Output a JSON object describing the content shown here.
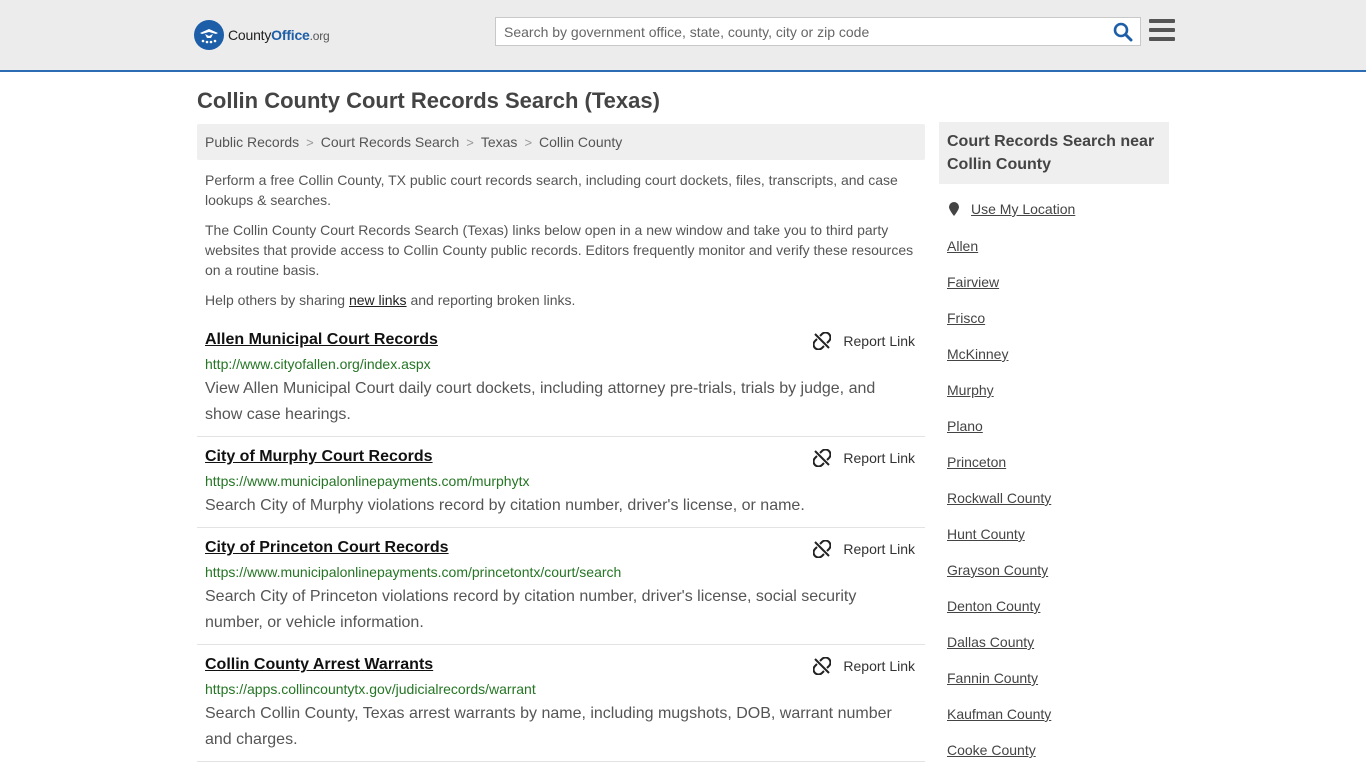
{
  "header": {
    "logo": {
      "word1": "County",
      "word2": "Office",
      "word3": ".org"
    },
    "search": {
      "placeholder": "Search by government office, state, county, city or zip code"
    }
  },
  "page_title": "Collin County Court Records Search (Texas)",
  "breadcrumb": [
    "Public Records",
    "Court Records Search",
    "Texas",
    "Collin County"
  ],
  "intro": {
    "p1": "Perform a free Collin County, TX public court records search, including court dockets, files, transcripts, and case lookups & searches.",
    "p2": "The Collin County Court Records Search (Texas) links below open in a new window and take you to third party websites that provide access to Collin County public records. Editors frequently monitor and verify these resources on a routine basis.",
    "p3_before": "Help others by sharing ",
    "p3_link": "new links",
    "p3_after": " and reporting broken links."
  },
  "report_label": "Report Link",
  "results": [
    {
      "title": "Allen Municipal Court Records",
      "url": "http://www.cityofallen.org/index.aspx",
      "description": "View Allen Municipal Court daily court dockets, including attorney pre-trials, trials by judge, and show case hearings."
    },
    {
      "title": "City of Murphy Court Records",
      "url": "https://www.municipalonlinepayments.com/murphytx",
      "description": "Search City of Murphy violations record by citation number, driver's license, or name."
    },
    {
      "title": "City of Princeton Court Records",
      "url": "https://www.municipalonlinepayments.com/princetontx/court/search",
      "description": "Search City of Princeton violations record by citation number, driver's license, social security number, or vehicle information."
    },
    {
      "title": "Collin County Arrest Warrants",
      "url": "https://apps.collincountytx.gov/judicialrecords/warrant",
      "description": "Search Collin County, Texas arrest warrants by name, including mugshots, DOB, warrant number and charges."
    }
  ],
  "sidebar": {
    "heading": "Court Records Search near Collin County",
    "use_location": "Use My Location",
    "links": [
      "Allen",
      "Fairview",
      "Frisco",
      "McKinney",
      "Murphy",
      "Plano",
      "Princeton",
      "Rockwall County",
      "Hunt County",
      "Grayson County",
      "Denton County",
      "Dallas County",
      "Fannin County",
      "Kaufman County",
      "Cooke County"
    ]
  },
  "colors": {
    "brand_blue": "#1d5ea8",
    "url_green": "#247524",
    "header_bg": "#ececec"
  },
  "icons": [
    "search-icon",
    "hamburger-menu-icon",
    "broken-link-icon",
    "map-marker-icon"
  ]
}
